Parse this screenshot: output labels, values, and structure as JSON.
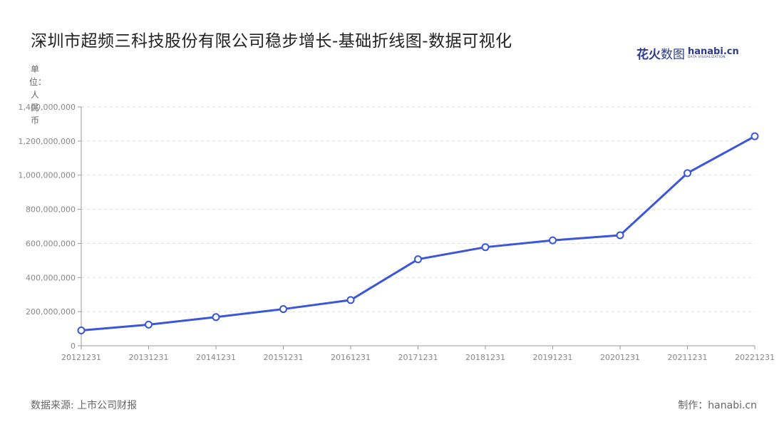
{
  "header": {
    "title": "深圳市超频三科技股份有限公司稳步增长-基础折线图-数据可视化",
    "logo_cn_a": "花火",
    "logo_cn_b": "数图",
    "logo_en": "hanabi.cn",
    "logo_en_sub": "DATA VISUALIZATION"
  },
  "footer": {
    "source": "数据来源: 上市公司财报",
    "maker": "制作：hanabi.cn"
  },
  "colors": {
    "line": "#3b56d8",
    "grid": "#dddddd",
    "axis": "#999999"
  },
  "chart_data": {
    "type": "line",
    "ylabel": "单位：人民币",
    "categories": [
      "20121231",
      "20131231",
      "20141231",
      "20151231",
      "20161231",
      "20171231",
      "20181231",
      "20191231",
      "20201231",
      "20211231",
      "20221231"
    ],
    "series": [
      {
        "values": [
          90000000,
          124000000,
          168000000,
          215000000,
          268000000,
          507000000,
          578000000,
          618000000,
          648000000,
          1012000000,
          1228000000
        ]
      }
    ],
    "ylim": [
      0,
      1400000000
    ],
    "yticks": [
      0,
      200000000,
      400000000,
      600000000,
      800000000,
      1000000000,
      1200000000,
      1400000000
    ],
    "ytick_labels": [
      "0",
      "200,000,000",
      "400,000,000",
      "600,000,000",
      "800,000,000",
      "1,000,000,000",
      "1,200,000,000",
      "1,400,000,000"
    ],
    "grid": true
  }
}
